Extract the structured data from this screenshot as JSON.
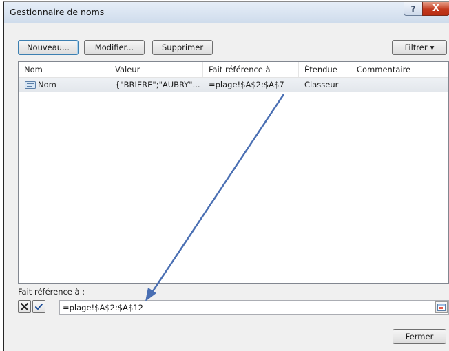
{
  "window": {
    "title": "Gestionnaire de noms",
    "help_symbol": "?",
    "close_symbol": "X"
  },
  "toolbar": {
    "new_label": "Nouveau...",
    "edit_label": "Modifier...",
    "delete_label": "Supprimer",
    "filter_label": "Filtrer",
    "filter_arrow": "▾"
  },
  "table": {
    "headers": [
      "Nom",
      "Valeur",
      "Fait référence à",
      "Étendue",
      "Commentaire"
    ],
    "rows": [
      {
        "nom": "Nom",
        "valeur": "{\"BRIERE\";\"AUBRY\"...",
        "reference": "=plage!$A$2:$A$7",
        "etendue": "Classeur",
        "commentaire": ""
      }
    ]
  },
  "reference": {
    "label": "Fait référence à :",
    "value": "=plage!$A$2:$A$12"
  },
  "footer": {
    "close_label": "Fermer"
  },
  "colors": {
    "annotation_arrow": "#4a6fb3",
    "close_button_red": "#c2391d"
  }
}
